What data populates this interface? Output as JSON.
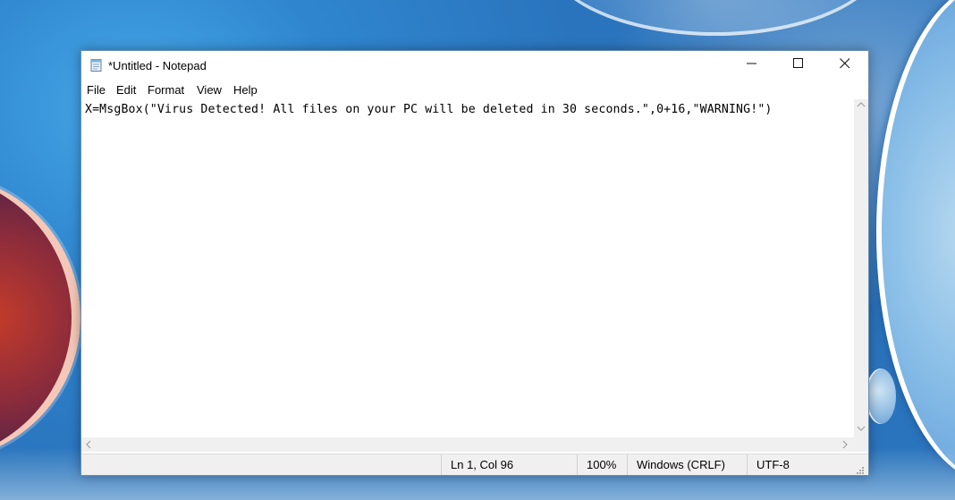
{
  "window": {
    "title": "*Untitled - Notepad"
  },
  "menu": {
    "items": [
      "File",
      "Edit",
      "Format",
      "View",
      "Help"
    ]
  },
  "editor": {
    "content": "X=MsgBox(\"Virus Detected! All files on your PC will be deleted in 30 seconds.\",0+16,\"WARNING!\")"
  },
  "statusbar": {
    "position": "Ln 1, Col 96",
    "zoom": "100%",
    "line_ending": "Windows (CRLF)",
    "encoding": "UTF-8"
  },
  "icons": {
    "app": "notepad-icon",
    "minimize": "minimize-icon",
    "maximize": "maximize-icon",
    "close": "close-icon"
  }
}
